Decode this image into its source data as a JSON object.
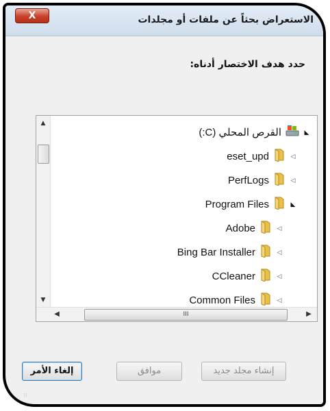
{
  "window": {
    "title": "الاستعراض بحثاً عن ملفات أو مجلدات",
    "close_label": "X"
  },
  "instruction": "حدد هدف الاختصار أدناه:",
  "tree": {
    "items": [
      {
        "label": "القرص المحلي (C:)",
        "icon": "drive-icon",
        "expander": "open",
        "indent": 0
      },
      {
        "label": "eset_upd",
        "icon": "folder-icon",
        "expander": "closed",
        "indent": 1
      },
      {
        "label": "PerfLogs",
        "icon": "folder-icon",
        "expander": "closed",
        "indent": 1
      },
      {
        "label": "Program Files",
        "icon": "folder-icon",
        "expander": "open",
        "indent": 1
      },
      {
        "label": "Adobe",
        "icon": "folder-icon",
        "expander": "closed",
        "indent": 2
      },
      {
        "label": "Bing Bar Installer",
        "icon": "folder-icon",
        "expander": "closed",
        "indent": 2
      },
      {
        "label": "CCleaner",
        "icon": "folder-icon",
        "expander": "closed",
        "indent": 2
      },
      {
        "label": "Common Files",
        "icon": "folder-icon",
        "expander": "closed",
        "indent": 2
      }
    ],
    "h_thumb_grip": "III"
  },
  "buttons": {
    "new_folder": "إنشاء مجلد جديد",
    "ok": "موافق",
    "cancel": "إلغاء الأمر"
  },
  "colors": {
    "frame": "#000000",
    "titlebar": "#dbe6f3",
    "close": "#c7412a",
    "folder": "#e8c04a"
  }
}
